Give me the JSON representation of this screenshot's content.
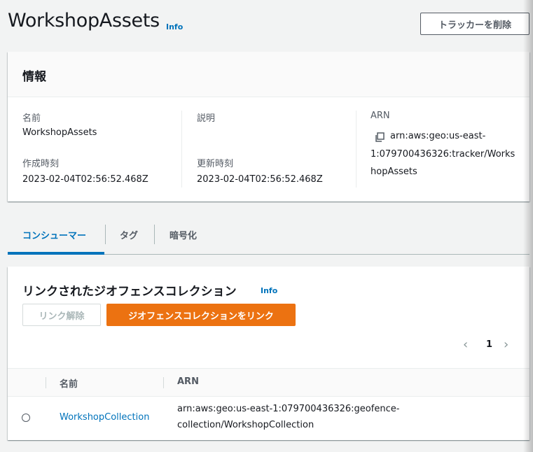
{
  "header": {
    "title": "WorkshopAssets",
    "info_label": "Info",
    "delete_button": "トラッカーを削除"
  },
  "info_panel": {
    "title": "情報",
    "name_label": "名前",
    "name_value": "WorkshopAssets",
    "created_label": "作成時刻",
    "created_value": "2023-02-04T02:56:52.468Z",
    "description_label": "説明",
    "description_value": "",
    "updated_label": "更新時刻",
    "updated_value": "2023-02-04T02:56:52.468Z",
    "arn_label": "ARN",
    "arn_lines": [
      "arn:aws:geo:us-east-",
      "1:079700436326:tracker/Works",
      "hopAssets"
    ]
  },
  "tabs": [
    {
      "label": "コンシューマー",
      "active": true
    },
    {
      "label": "タグ",
      "active": false
    },
    {
      "label": "暗号化",
      "active": false
    }
  ],
  "consumers": {
    "title": "リンクされたジオフェンスコレクション",
    "info_label": "Info",
    "unlink_button": "リンク解除",
    "link_button": "ジオフェンスコレクションをリンク",
    "pager": {
      "prev": "‹",
      "page": "1",
      "next": "›"
    },
    "columns": [
      "名前",
      "ARN"
    ],
    "rows": [
      {
        "name": "WorkshopCollection",
        "arn_lines": [
          "arn:aws:geo:us-east-1:079700436326:geofence-",
          "collection/WorkshopCollection"
        ]
      }
    ]
  },
  "colors": {
    "link": "#0073bb",
    "primary_button": "#ec7211",
    "background": "#f2f3f3"
  },
  "icons": [
    "copy-icon",
    "chevron-left-icon",
    "chevron-right-icon",
    "radio-icon"
  ]
}
